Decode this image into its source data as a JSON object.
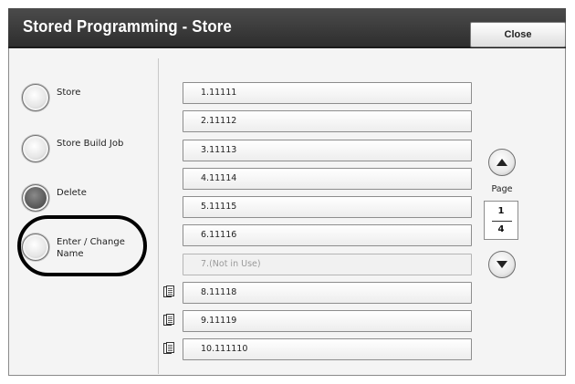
{
  "header": {
    "title": "Stored Programming - Store",
    "close_label": "Close"
  },
  "actions": [
    {
      "label": "Store",
      "selected": false
    },
    {
      "label": "Store Build Job",
      "selected": false
    },
    {
      "label": "Delete",
      "selected": true
    },
    {
      "label": "Enter / Change Name",
      "selected": false
    }
  ],
  "slots": [
    {
      "label": "1.11111",
      "in_use": true,
      "doc_icon": false
    },
    {
      "label": "2.11112",
      "in_use": true,
      "doc_icon": false
    },
    {
      "label": "3.11113",
      "in_use": true,
      "doc_icon": false
    },
    {
      "label": "4.11114",
      "in_use": true,
      "doc_icon": false
    },
    {
      "label": "5.11115",
      "in_use": true,
      "doc_icon": false
    },
    {
      "label": "6.11116",
      "in_use": true,
      "doc_icon": false
    },
    {
      "label": "7.(Not in Use)",
      "in_use": false,
      "doc_icon": false
    },
    {
      "label": "8.11118",
      "in_use": true,
      "doc_icon": true
    },
    {
      "label": "9.11119",
      "in_use": true,
      "doc_icon": true
    },
    {
      "label": "10.111110",
      "in_use": true,
      "doc_icon": true
    }
  ],
  "pager": {
    "label": "Page",
    "current": "1",
    "total": "4"
  },
  "colors": {
    "titlebar": "#3a3a3a",
    "panel": "#f4f4f4",
    "selected_radio": "#5a5a5a"
  }
}
